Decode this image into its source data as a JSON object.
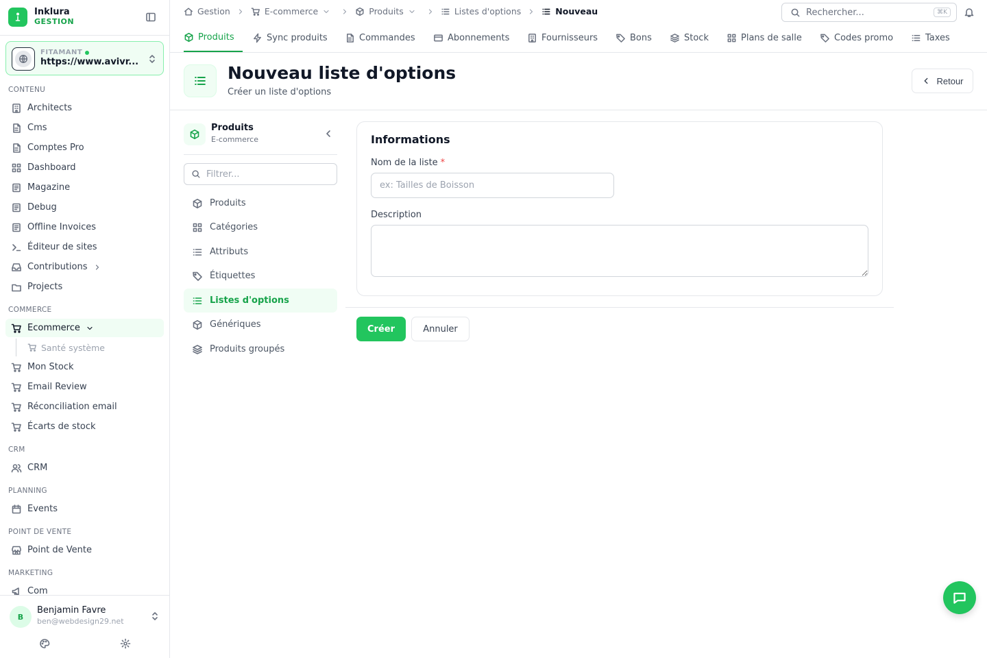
{
  "brand": {
    "name": "Inklura",
    "subtitle": "GESTION"
  },
  "site": {
    "label": "FITAMANT",
    "url": "https://www.avivr..."
  },
  "sidebar": {
    "sections": {
      "contenu": "CONTENU",
      "commerce": "COMMERCE",
      "crm": "CRM",
      "planning": "PLANNING",
      "pos": "POINT DE VENTE",
      "marketing": "MARKETING"
    },
    "items": {
      "architects": "Architects",
      "cms": "Cms",
      "comptes_pro": "Comptes Pro",
      "dashboard": "Dashboard",
      "magazine": "Magazine",
      "debug": "Debug",
      "offline_invoices": "Offline Invoices",
      "editeur_sites": "Éditeur de sites",
      "contributions": "Contributions",
      "projects": "Projects",
      "ecommerce": "Ecommerce",
      "sante_systeme": "Santé système",
      "mon_stock": "Mon Stock",
      "email_review": "Email Review",
      "reconciliation_email": "Réconciliation email",
      "ecarts_stock": "Écarts de stock",
      "crm": "CRM",
      "events": "Events",
      "point_de_vente": "Point de Vente",
      "com": "Com"
    }
  },
  "user": {
    "initial": "B",
    "name": "Benjamin Favre",
    "email": "ben@webdesign29.net"
  },
  "breadcrumb": [
    "Gestion",
    "E-commerce",
    "Produits",
    "Listes d'options",
    "Nouveau"
  ],
  "search": {
    "placeholder": "Rechercher...",
    "shortcut": "⌘K"
  },
  "tabs": [
    "Produits",
    "Sync produits",
    "Commandes",
    "Abonnements",
    "Fournisseurs",
    "Bons",
    "Stock",
    "Plans de salle",
    "Codes promo",
    "Taxes"
  ],
  "page": {
    "title": "Nouveau liste d'options",
    "subtitle": "Créer un liste d'options",
    "back_label": "Retour"
  },
  "subnav": {
    "title": "Produits",
    "subtitle": "E-commerce",
    "filter_placeholder": "Filtrer...",
    "items": [
      "Produits",
      "Catégories",
      "Attributs",
      "Étiquettes",
      "Listes d'options",
      "Génériques",
      "Produits groupés"
    ]
  },
  "form": {
    "card_title": "Informations",
    "name_label": "Nom de la liste",
    "required_mark": "*",
    "name_value": "",
    "name_placeholder": "ex: Tailles de Boisson",
    "description_label": "Description",
    "description_value": "",
    "submit_label": "Créer",
    "cancel_label": "Annuler"
  },
  "colors": {
    "accent": "#22c55e",
    "accent_dark": "#16a34a",
    "accent_bg": "#f0fdf4",
    "required": "#ef4444"
  }
}
